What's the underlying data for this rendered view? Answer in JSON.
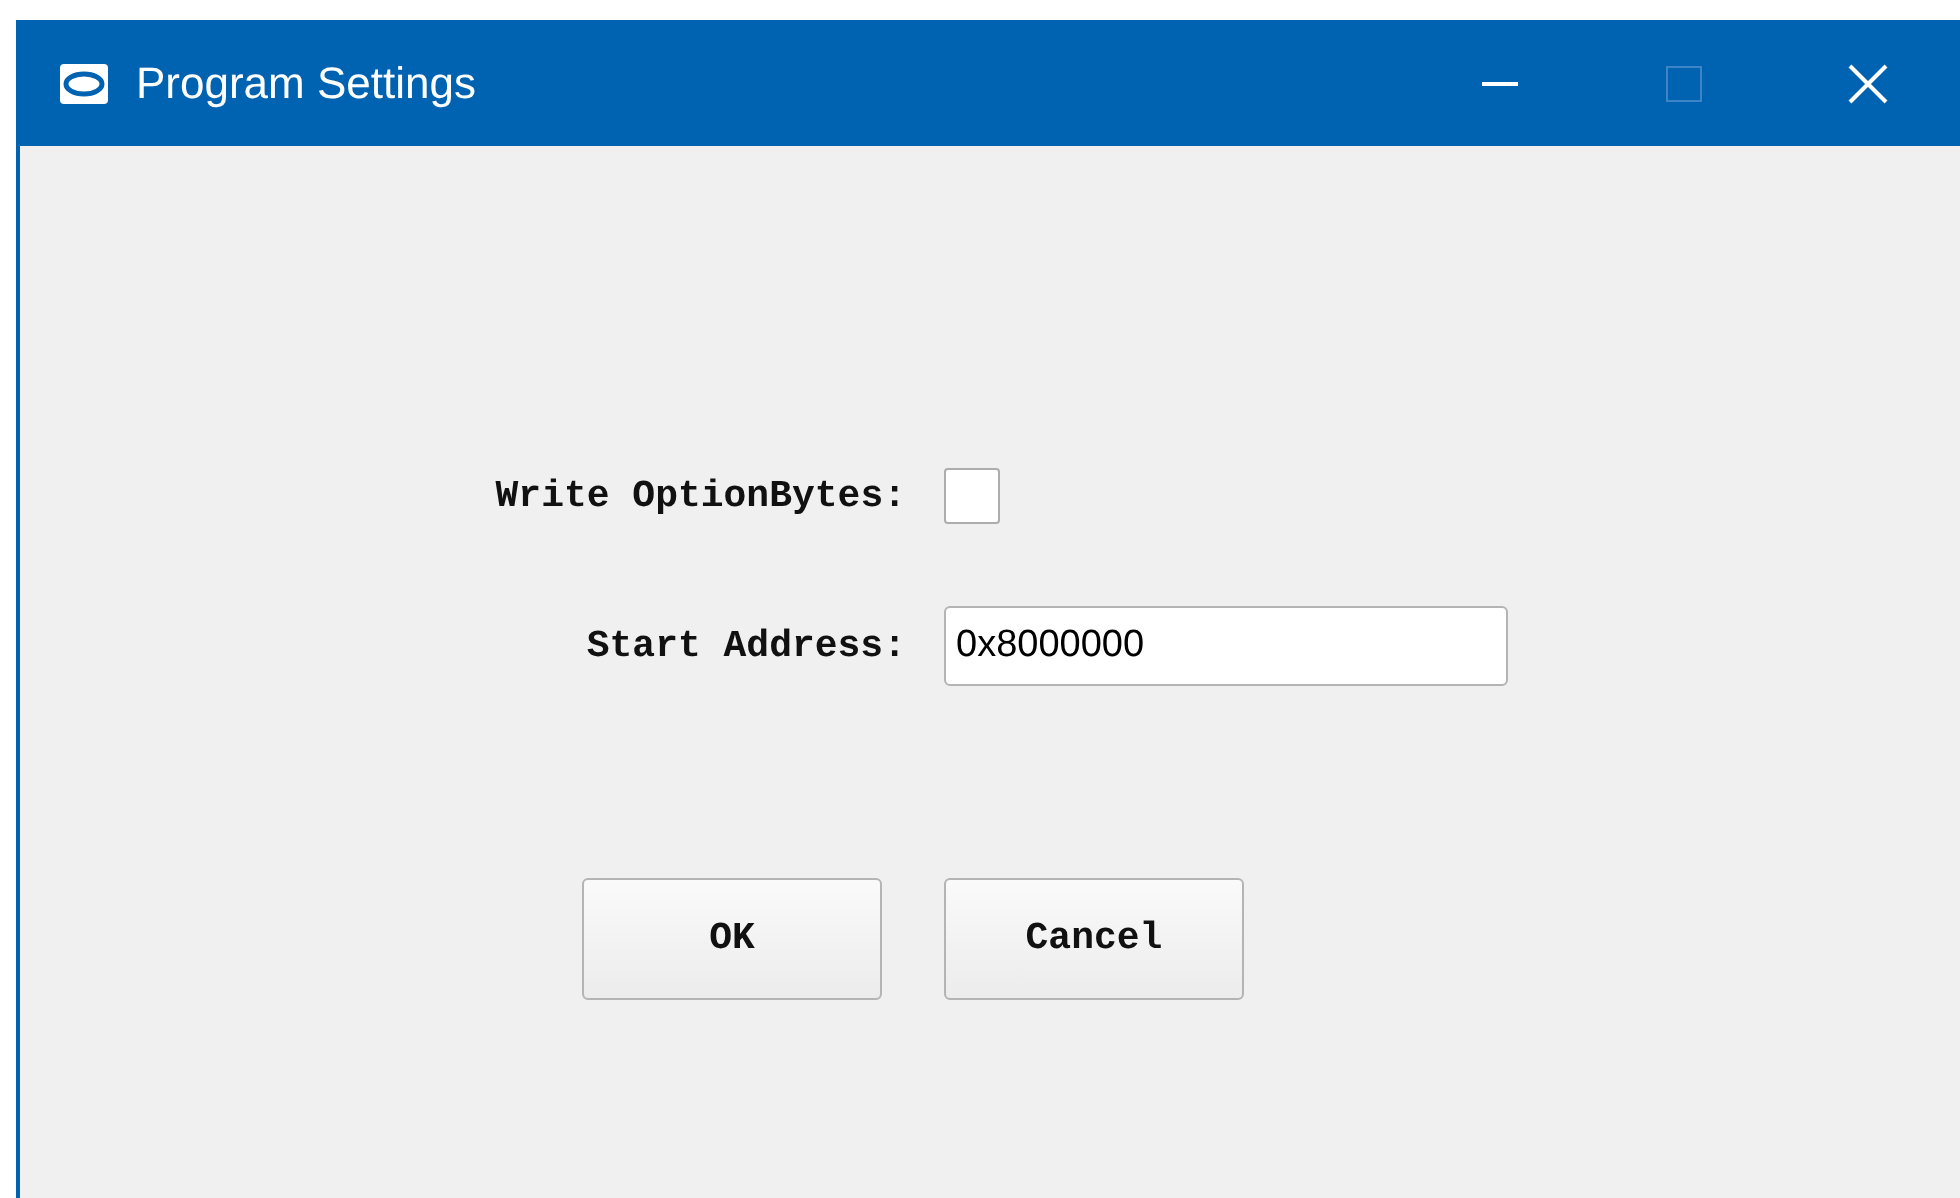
{
  "window": {
    "title": "Program Settings",
    "maximize_disabled": true
  },
  "form": {
    "option_bytes": {
      "label": "Write OptionBytes:",
      "checked": false
    },
    "start_address": {
      "label": "Start Address:",
      "value": "0x8000000"
    }
  },
  "buttons": [
    {
      "label": "OK"
    },
    {
      "label": "Cancel"
    }
  ]
}
